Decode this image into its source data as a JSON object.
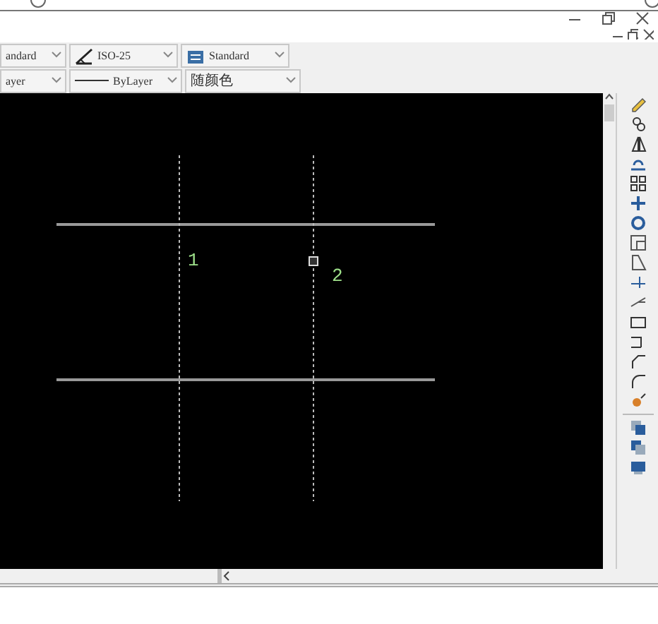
{
  "window_controls": [
    {
      "kind": "minimize"
    },
    {
      "kind": "restore"
    },
    {
      "kind": "close"
    }
  ],
  "document_controls": [
    {
      "kind": "minimize"
    },
    {
      "kind": "restore"
    },
    {
      "kind": "close"
    }
  ],
  "toolbars": [
    [
      {
        "kind": "plain",
        "value": "andard"
      },
      {
        "kind": "dimension",
        "value": "ISO-25"
      },
      {
        "kind": "table",
        "value": "Standard"
      }
    ],
    [
      {
        "kind": "plain",
        "value": "ayer"
      },
      {
        "kind": "linetype",
        "value": "ByLayer"
      },
      {
        "kind": "plain",
        "value": "随颜色"
      }
    ]
  ],
  "drawing": {
    "labels": [
      {
        "text": "1"
      },
      {
        "text": "2"
      }
    ]
  }
}
